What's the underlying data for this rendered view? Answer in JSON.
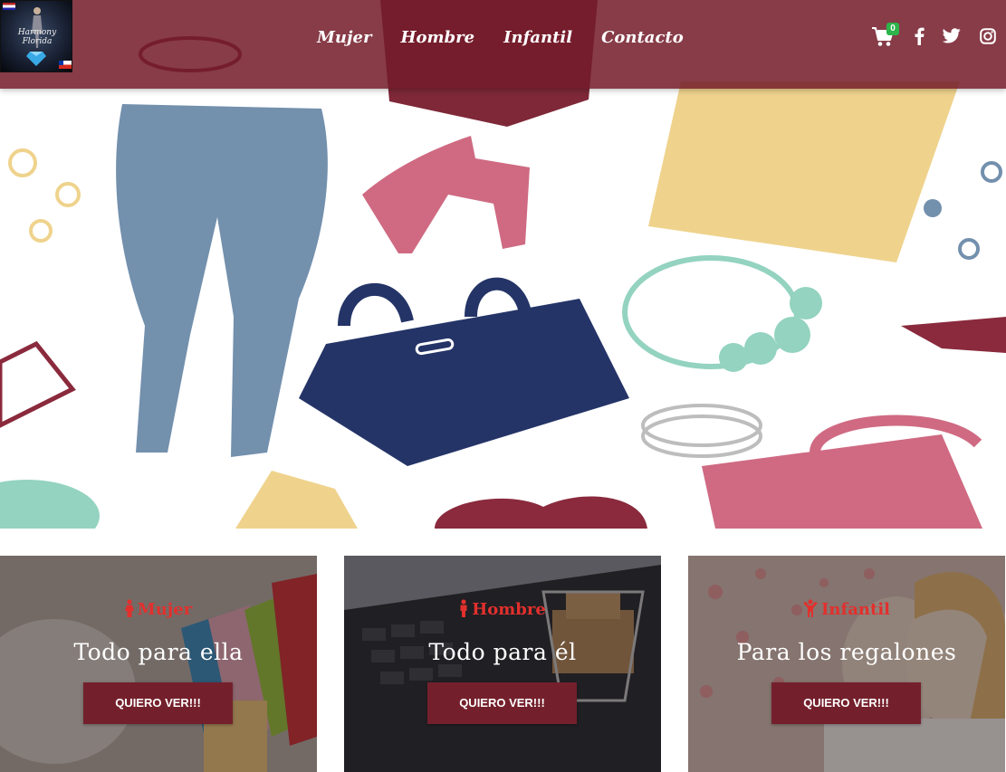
{
  "brand": {
    "logo_text": "Harmony Florida",
    "accent_color": "#74202c",
    "nav_bg": "#731c2a"
  },
  "nav": {
    "links": [
      {
        "label": "Mujer"
      },
      {
        "label": "Hombre"
      },
      {
        "label": "Infantil"
      },
      {
        "label": "Contacto"
      }
    ],
    "cart_count": "0",
    "icons": [
      "shopping-cart-icon",
      "facebook-icon",
      "twitter-icon",
      "instagram-icon"
    ]
  },
  "hero": {
    "image": "fashion-accessories-pattern"
  },
  "cards": [
    {
      "tag": "Mujer",
      "tag_icon": "female-icon",
      "title": "Todo para ella",
      "button": "QUIERO VER!!!"
    },
    {
      "tag": "Hombre",
      "tag_icon": "male-icon",
      "title": "Todo para él",
      "button": "QUIERO VER!!!"
    },
    {
      "tag": "Infantil",
      "tag_icon": "child-icon",
      "title": "Para los regalones",
      "button": "QUIERO VER!!!"
    }
  ],
  "colors": {
    "card_tag": "#e2302d",
    "cart_badge": "#2db44a"
  }
}
